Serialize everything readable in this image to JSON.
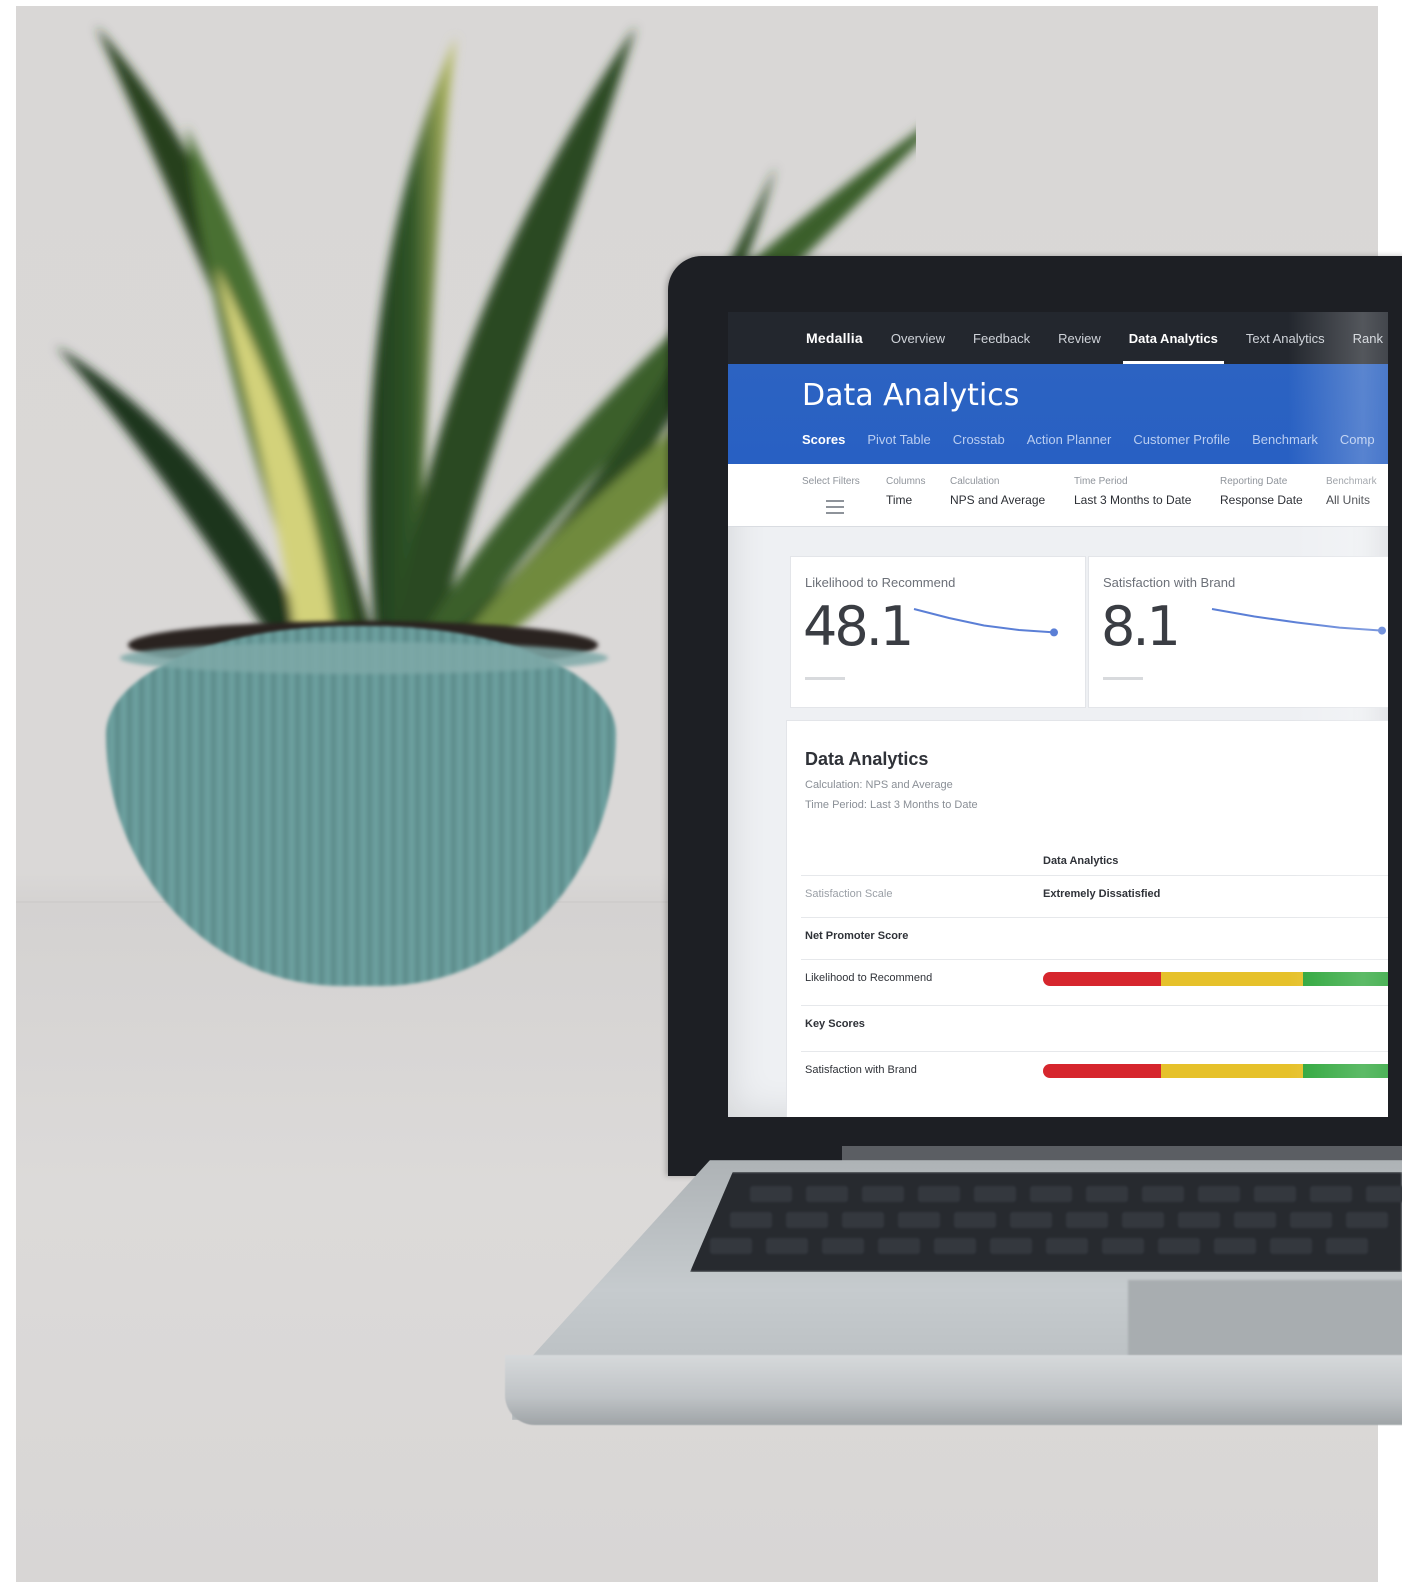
{
  "app": {
    "brand": "Medallia",
    "nav": [
      "Overview",
      "Feedback",
      "Review",
      "Data Analytics",
      "Text Analytics",
      "Rank"
    ],
    "active_nav": "Data Analytics"
  },
  "hero": {
    "title": "Data Analytics",
    "subtabs": [
      "Scores",
      "Pivot Table",
      "Crosstab",
      "Action Planner",
      "Customer Profile",
      "Benchmark",
      "Comp"
    ]
  },
  "filters": {
    "select_filters_label": "Select Filters",
    "columns": {
      "label": "Columns",
      "value": "Time"
    },
    "calculation": {
      "label": "Calculation",
      "value": "NPS and Average"
    },
    "time_period": {
      "label": "Time Period",
      "value": "Last 3 Months to Date"
    },
    "reporting_date": {
      "label": "Reporting Date",
      "value": "Response Date"
    },
    "benchmark": {
      "label": "Benchmark",
      "value": "All Units"
    }
  },
  "cards": [
    {
      "label": "Likelihood to Recommend",
      "value": "48.1",
      "spark": [
        0.0,
        0.3,
        0.55,
        0.7,
        0.78
      ]
    },
    {
      "label": "Satisfaction with Brand",
      "value": "8.1",
      "spark": [
        0.0,
        0.25,
        0.45,
        0.62,
        0.72
      ]
    }
  ],
  "panel": {
    "title": "Data Analytics",
    "subtitle_1": "Calculation: NPS and Average",
    "subtitle_2": "Time Period: Last 3 Months to Date",
    "column_header": "Data Analytics",
    "rows": [
      {
        "label": "Satisfaction Scale",
        "value": "Extremely Dissatisfied",
        "style": "muted"
      },
      {
        "label": "Net Promoter Score",
        "value": "",
        "style": "bold"
      },
      {
        "label": "Likelihood to Recommend",
        "value": "",
        "style": "normal",
        "bar": [
          0.28,
          0.34,
          0.38
        ]
      },
      {
        "label": "Key Scores",
        "value": "",
        "style": "bold"
      },
      {
        "label": "Satisfaction with Brand",
        "value": "",
        "style": "normal",
        "bar": [
          0.28,
          0.34,
          0.38
        ]
      }
    ]
  },
  "colors": {
    "nav_bg": "#23272e",
    "hero_bg": "#2c63c2",
    "bar_red": "#d6262d",
    "bar_yellow": "#e6c12a",
    "bar_green": "#2fa73c",
    "spark_line": "#5b7fd6"
  },
  "icons": {
    "filters": "sliders-icon"
  }
}
